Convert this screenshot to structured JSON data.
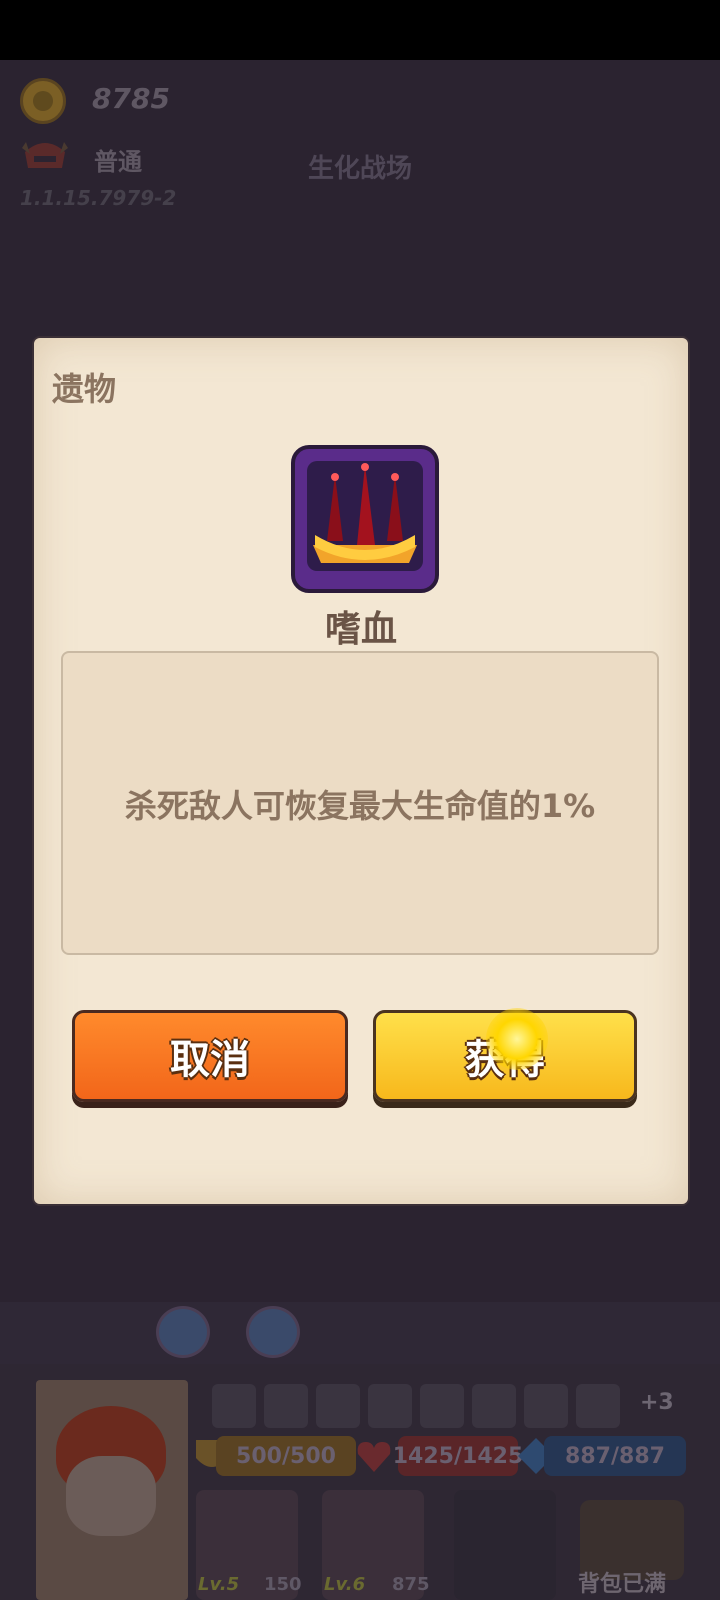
{
  "hud": {
    "coins": "8785",
    "difficulty": "普通",
    "stage": "生化战场",
    "version": "1.1.15.7979-2"
  },
  "dialog": {
    "title": "遗物",
    "relic_name": "嗜血",
    "description": "杀死敌人可恢复最大生命值的1%",
    "cancel_label": "取消",
    "get_label": "获得"
  },
  "bottom": {
    "more_count": "+3",
    "shield": "500/500",
    "hp": "1425/1425",
    "mp": "887/887",
    "equip1_level": "Lv.5",
    "equip1_value": "150",
    "equip2_level": "Lv.6",
    "equip2_value": "875",
    "bag_status": "背包已满"
  },
  "colors": {
    "cancel": "#f2661a",
    "get": "#f7b81c",
    "panel": "#f3e7d3"
  }
}
